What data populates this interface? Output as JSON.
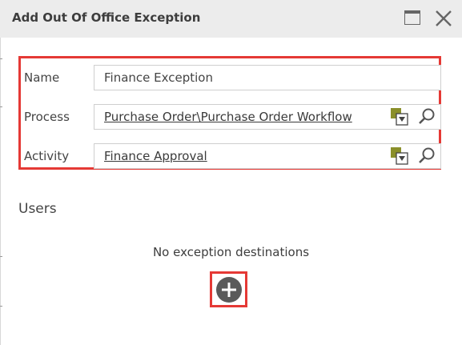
{
  "dialog": {
    "title": "Add Out Of Office Exception"
  },
  "form": {
    "name": {
      "label": "Name",
      "value": "Finance Exception"
    },
    "process": {
      "label": "Process",
      "value": "Purchase Order\\Purchase Order Workflow"
    },
    "activity": {
      "label": "Activity",
      "value": "Finance Approval"
    }
  },
  "users": {
    "heading": "Users",
    "empty_message": "No exception destinations"
  },
  "colors": {
    "highlight": "#e53935",
    "titlebar_bg": "#ececec",
    "picker_olive": "#8a8f2a",
    "add_button": "#5a5a5a"
  },
  "icons": [
    "maximize-icon",
    "close-icon",
    "picker-icon",
    "search-icon",
    "add-icon"
  ]
}
